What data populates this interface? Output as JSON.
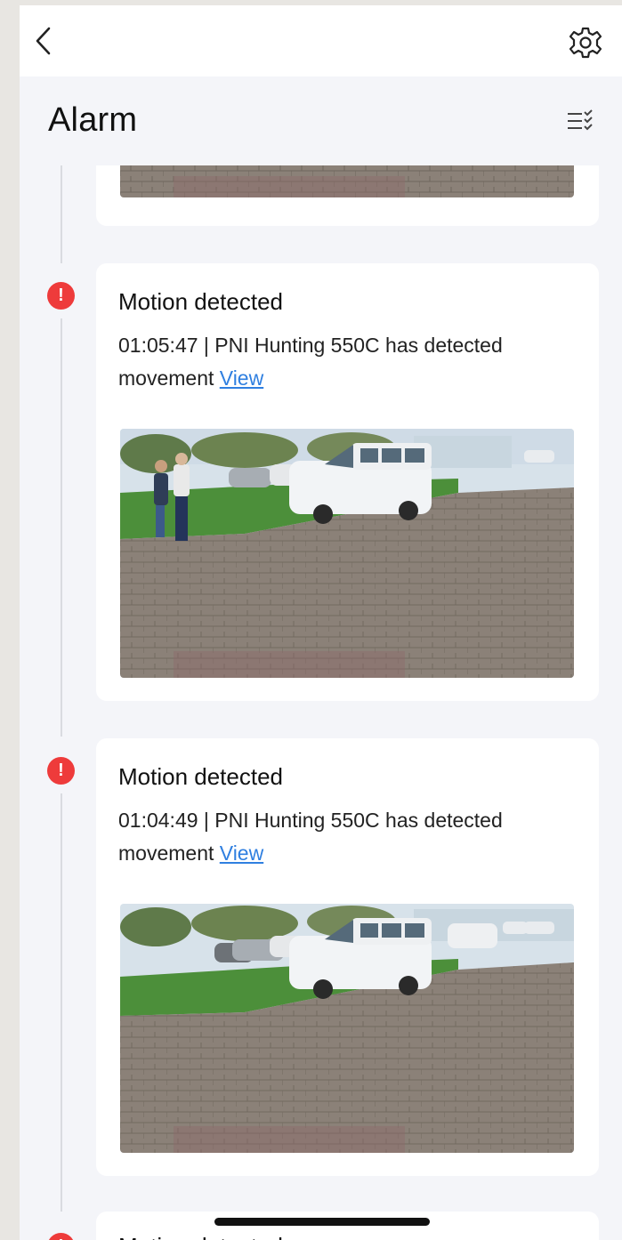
{
  "header": {
    "title": "Alarm"
  },
  "icons": {
    "back": "chevron-left-icon",
    "settings": "gear-icon",
    "filter": "list-check-icon",
    "alert": "exclamation-icon"
  },
  "colors": {
    "alert": "#ee3b3b",
    "link": "#2f7fe0",
    "background": "#f4f5f9"
  },
  "events": [
    {
      "title": "Motion detected",
      "time": "01:05:47",
      "description": "01:05:47 | PNI Hunting 550C has detected movement",
      "view_label": "View"
    },
    {
      "title": "Motion detected",
      "time": "01:04:49",
      "description": "01:04:49 | PNI Hunting 550C has detected movement",
      "view_label": "View"
    },
    {
      "title": "Motion detected"
    }
  ]
}
